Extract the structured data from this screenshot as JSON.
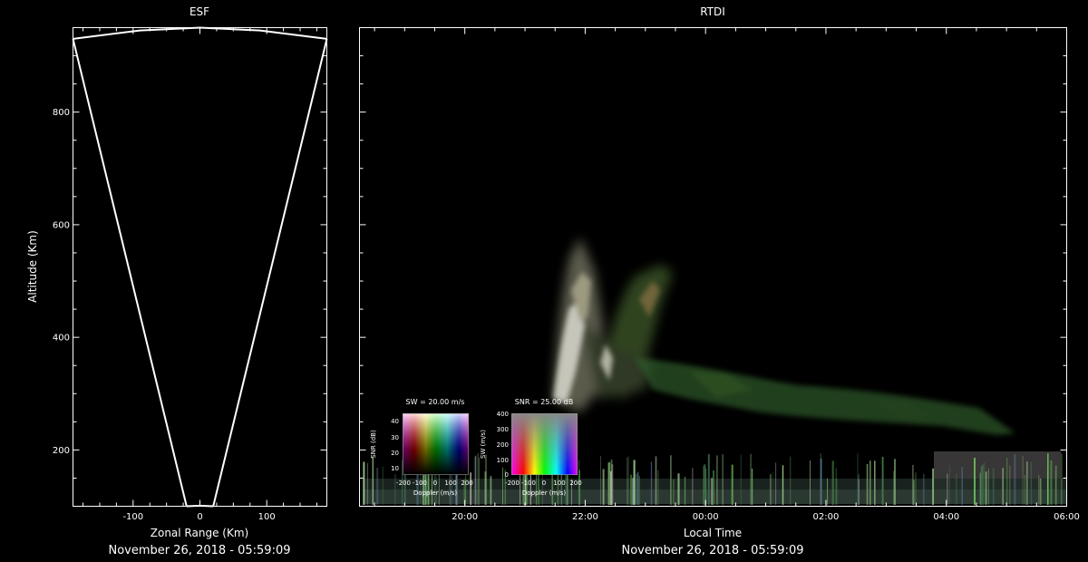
{
  "esf": {
    "title": "ESF",
    "xlabel": "Zonal Range (Km)",
    "ylabel": "Altitude (Km)",
    "footer": "November 26, 2018 - 05:59:09",
    "xticks": [
      "-100",
      "0",
      "100"
    ],
    "yticks": [
      "200",
      "400",
      "600",
      "800"
    ]
  },
  "rtdi": {
    "title": "RTDI",
    "xlabel": "Local Time",
    "footer": "November 26, 2018 - 05:59:09",
    "xticks": [
      "20:00",
      "22:00",
      "00:00",
      "02:00",
      "04:00",
      "06:00"
    ]
  },
  "legend_sw": {
    "title": "SW = 20.00 m/s",
    "xlabel": "Doppler (m/s)",
    "ylabel": "SNR (dB)",
    "xticks": [
      "-200",
      "-100",
      "0",
      "100",
      "200"
    ],
    "yticks": [
      "10",
      "20",
      "30",
      "40"
    ]
  },
  "legend_snr": {
    "title": "SNR = 25.00 dB",
    "xlabel": "Doppler (m/s)",
    "ylabel": "SW (m/s)",
    "xticks": [
      "-200",
      "-100",
      "0",
      "100",
      "200"
    ],
    "yticks": [
      "0",
      "100",
      "200",
      "300",
      "400"
    ]
  },
  "chart_data": [
    {
      "type": "line",
      "panel": "ESF",
      "title": "ESF",
      "xlabel": "Zonal Range (Km)",
      "ylabel": "Altitude (Km)",
      "xlim": [
        -190,
        190
      ],
      "ylim": [
        100,
        950
      ],
      "x_ticks": [
        -100,
        0,
        100
      ],
      "y_ticks": [
        200,
        400,
        600,
        800
      ],
      "series": [
        {
          "values": [
            [
              -190,
              930
            ],
            [
              -90,
              945
            ],
            [
              0,
              950
            ],
            [
              90,
              945
            ],
            [
              190,
              930
            ]
          ]
        },
        {
          "values": [
            [
              -190,
              930
            ],
            [
              -20,
              100
            ]
          ]
        },
        {
          "values": [
            [
              190,
              930
            ],
            [
              20,
              100
            ]
          ]
        },
        {
          "values": [
            [
              -20,
              100
            ],
            [
              0,
              101
            ],
            [
              20,
              100
            ]
          ]
        }
      ],
      "grid": false
    },
    {
      "type": "heatmap",
      "panel": "RTDI",
      "title": "RTDI",
      "xlabel": "Local Time",
      "ylabel": "",
      "x_ticks": [
        "20:00",
        "22:00",
        "00:00",
        "02:00",
        "04:00",
        "06:00"
      ],
      "x_range_hours": [
        18.25,
        30.0
      ],
      "ylim": [
        100,
        950
      ],
      "grid": false
    }
  ]
}
